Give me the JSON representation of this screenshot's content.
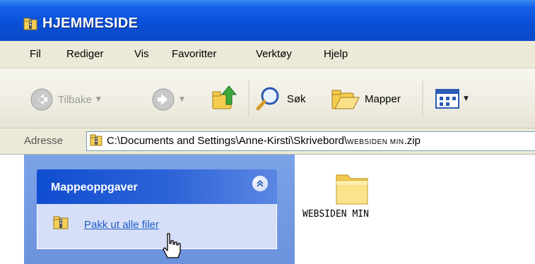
{
  "window": {
    "title": "HJEMMESIDE"
  },
  "menu": {
    "items": [
      "Fil",
      "Rediger",
      "Vis",
      "Favoritter",
      "Verktøy",
      "Hjelp"
    ]
  },
  "toolbar": {
    "back_label": "Tilbake",
    "search_label": "Søk",
    "folders_label": "Mapper",
    "icons": [
      "back-arrow-icon",
      "forward-arrow-icon",
      "up-folder-icon",
      "search-magnifier-icon",
      "folders-icon",
      "views-icon"
    ]
  },
  "address": {
    "label": "Adresse",
    "path_prefix": "C:\\Documents and Settings\\Anne-Kirsti\\Skrivebord\\",
    "path_folder": "WEBSIDEN MIN",
    "path_suffix": ".zip"
  },
  "tasks": {
    "title": "Mappeoppgaver",
    "items": [
      {
        "label": "Pakk ut alle filer",
        "icon": "zip-folder-icon"
      }
    ]
  },
  "content": {
    "items": [
      {
        "label": "WEBSIDEN MIN",
        "icon": "folder-icon"
      }
    ]
  },
  "colors": {
    "titlebar": "#0b4fd8",
    "panel": "#7ba2e7",
    "link": "#215dc6",
    "chrome": "#ece9d8"
  }
}
